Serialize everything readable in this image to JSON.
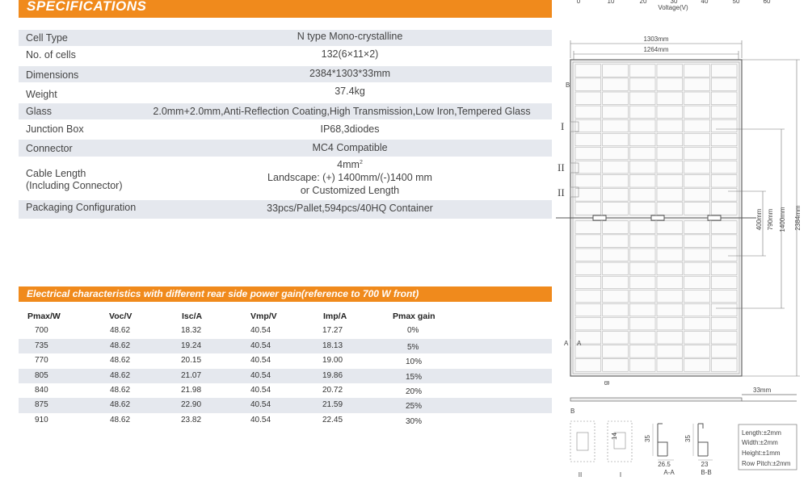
{
  "spec": {
    "title": "SPECIFICATIONS",
    "rows": [
      {
        "label": "Cell Type",
        "value": "N type Mono-crystalline"
      },
      {
        "label": "No. of cells",
        "value": "132(6×11×2)"
      },
      {
        "label": "Dimensions",
        "value": "2384*1303*33mm"
      },
      {
        "label": "Weight",
        "value": "37.4kg"
      },
      {
        "label": "Glass",
        "value": "2.0mm+2.0mm,Anti-Reflection Coating,High Transmission,Low Iron,Tempered Glass"
      },
      {
        "label": "Junction Box",
        "value": "IP68,3diodes"
      },
      {
        "label": "Connector",
        "value": "MC4  Compatible"
      },
      {
        "label": "Cable Length",
        "label2": "(Including Connector)",
        "value": "4mm",
        "value_sup": "2",
        "value2": "Landscape: (+) 1400mm/(-)1400 mm",
        "value3": "or Customized Length"
      },
      {
        "label": "Packaging Configuration",
        "value": "33pcs/Pallet,594pcs/40HQ Container"
      }
    ]
  },
  "electrical": {
    "title": "Electrical characteristics with different rear side power gain(reference to 700 W front)",
    "headers": [
      "Pmax/W",
      "Voc/V",
      "Isc/A",
      "Vmp/V",
      "Imp/A",
      "Pmax gain"
    ],
    "rows": [
      [
        "700",
        "48.62",
        "18.32",
        "40.54",
        "17.27",
        "0%"
      ],
      [
        "735",
        "48.62",
        "19.24",
        "40.54",
        "18.13",
        "5%"
      ],
      [
        "770",
        "48.62",
        "20.15",
        "40.54",
        "19.00",
        "10%"
      ],
      [
        "805",
        "48.62",
        "21.07",
        "40.54",
        "19.86",
        "15%"
      ],
      [
        "840",
        "48.62",
        "21.98",
        "40.54",
        "20.72",
        "20%"
      ],
      [
        "875",
        "48.62",
        "22.90",
        "40.54",
        "21.59",
        "25%"
      ],
      [
        "910",
        "48.62",
        "23.82",
        "40.54",
        "22.45",
        "30%"
      ]
    ]
  },
  "chart_fragment": {
    "ticks": [
      "0",
      "10",
      "20",
      "30",
      "40",
      "50",
      "60"
    ],
    "xlabel": "Voltage(V)"
  },
  "drawing": {
    "width_outer": "1303mm",
    "width_inner": "1264mm",
    "height_total": "2384mm",
    "height_1400": "1400mm",
    "height_790": "790mm",
    "height_400": "400mm",
    "thickness": "33mm",
    "label_b": "B",
    "label_a": "A",
    "label_i": "I",
    "label_ii": "II",
    "label_aa": "A-A",
    "label_bb": "B-B",
    "dim_14": "14",
    "dim_35": "35",
    "dim_265": "26.5",
    "dim_23": "23",
    "tolerances": [
      "Length:±2mm",
      "Width:±2mm",
      "Height:±1mm",
      "Row Pitch:±2mm"
    ]
  },
  "colors": {
    "accent": "#f08a1c",
    "row_shade": "#e5e8ee"
  }
}
